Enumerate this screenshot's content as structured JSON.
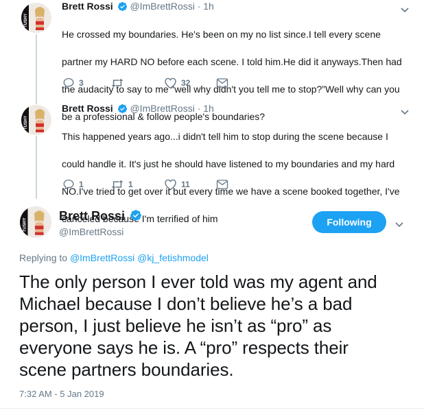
{
  "tweets": [
    {
      "name": "Brett Rossi",
      "handle": "@ImBrettRossi",
      "dot": "·",
      "time": "1h",
      "text_lines": [
        "He crossed my boundaries. He's been on my no list since.I tell every scene",
        "partner my HARD NO before each scene. I told him.He did it anyways.Then had",
        "the audacity to say to me “well why didn't you tell me to stop?”Well why can you",
        "be a professional & follow people's boundaries?"
      ],
      "replies": "3",
      "retweets": "",
      "likes": "32"
    },
    {
      "name": "Brett Rossi",
      "handle": "@ImBrettRossi",
      "dot": "·",
      "time": "1h",
      "text_lines": [
        "This happened years ago...i didn't tell him to stop during the scene because I",
        "could handle it. It's just he should have listened to my boundaries and my hard",
        "NO.I've tried to get over it but every time we have a scene booked together, I've",
        "canceled because I'm terrified of him"
      ],
      "replies": "1",
      "retweets": "1",
      "likes": "11"
    }
  ],
  "main": {
    "name": "Brett Rossi",
    "handle": "@ImBrettRossi",
    "follow_label": "Following",
    "replying_prefix": "Replying to",
    "replying_to": [
      "@ImBrettRossi",
      "@kj_fetishmodel"
    ],
    "text_lines": [
      "The only person I ever told was my agent and",
      "Michael because I don’t believe he’s a bad",
      "person, I just believe he isn’t as “pro” as",
      "everyone says he is. A “pro” respects their",
      "scene partners boundaries."
    ],
    "timestamp": "7:32 AM - 5 Jan 2019"
  },
  "avatar_label": "TUSHY",
  "colors": {
    "accent": "#1da1f2",
    "muted": "#657786",
    "text": "#14171a",
    "thread_line": "#ccd6dd"
  },
  "icons": {
    "reply": "reply-icon",
    "retweet": "retweet-icon",
    "like": "heart-icon",
    "dm": "envelope-icon",
    "verified": "verified-badge-icon",
    "caret": "chevron-down-icon"
  }
}
